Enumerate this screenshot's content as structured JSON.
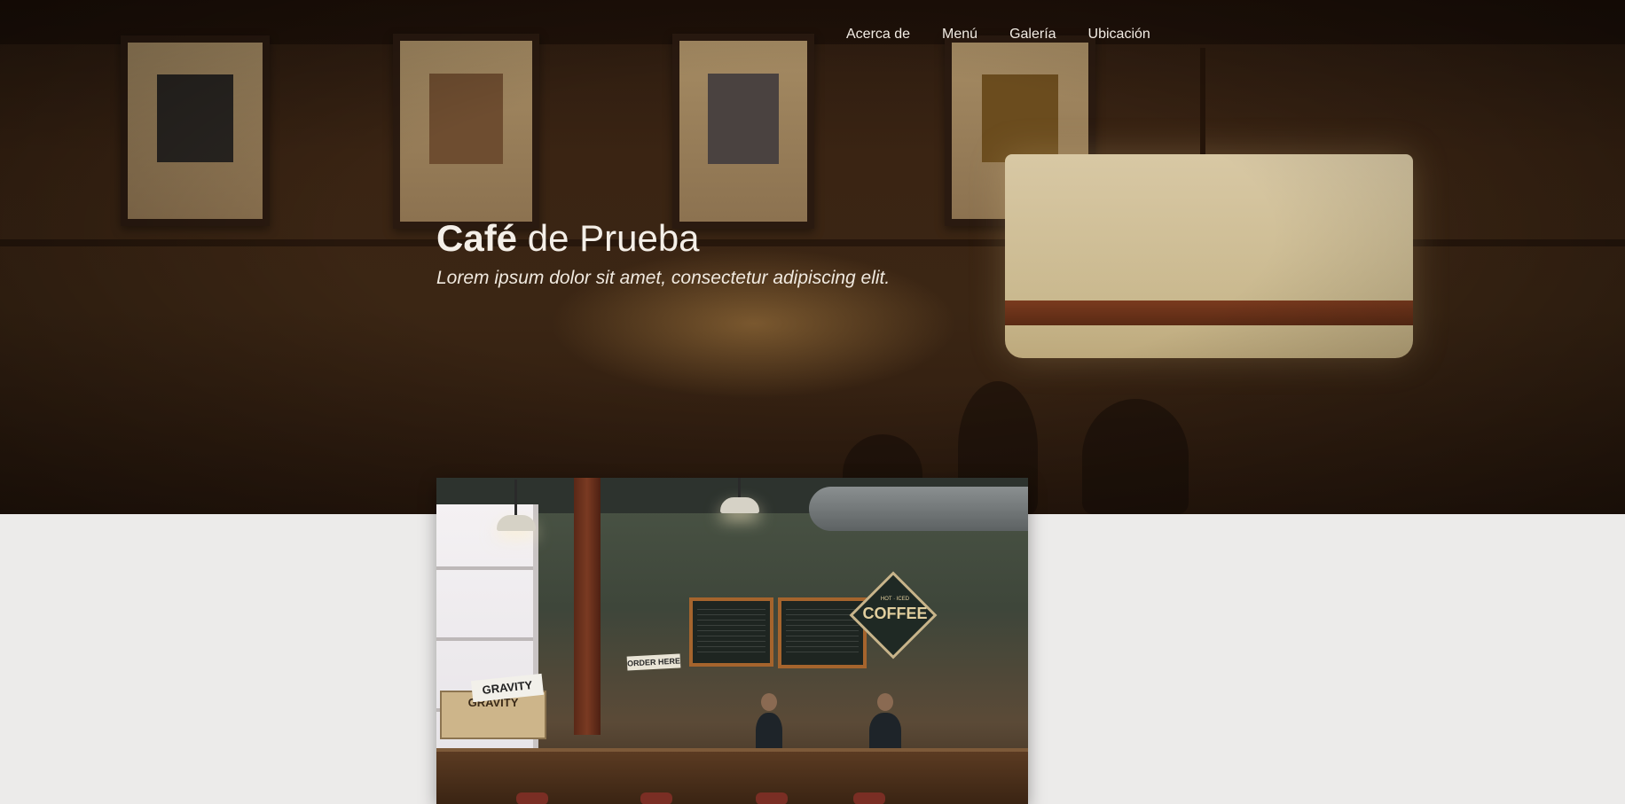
{
  "nav": {
    "items": [
      {
        "label": "Acerca de"
      },
      {
        "label": "Menú"
      },
      {
        "label": "Galería"
      },
      {
        "label": "Ubicación"
      }
    ]
  },
  "hero": {
    "title_bold": "Café",
    "title_rest": "de Prueba",
    "subtitle": "Lorem ipsum dolor sit amet, consectetur adipiscing elit."
  },
  "feature_image": {
    "sign_coffee": "COFFEE",
    "sign_coffee_top": "HOT · ICED",
    "sign_order": "ORDER HERE",
    "sign_gravity_paper": "GRAVITY",
    "sign_gravity_box": "GRAVITY"
  },
  "colors": {
    "page_background": "#ecebea",
    "hero_tint": "#3b2614",
    "nav_text": "#f2ece4",
    "board_frame": "#a5642d"
  }
}
